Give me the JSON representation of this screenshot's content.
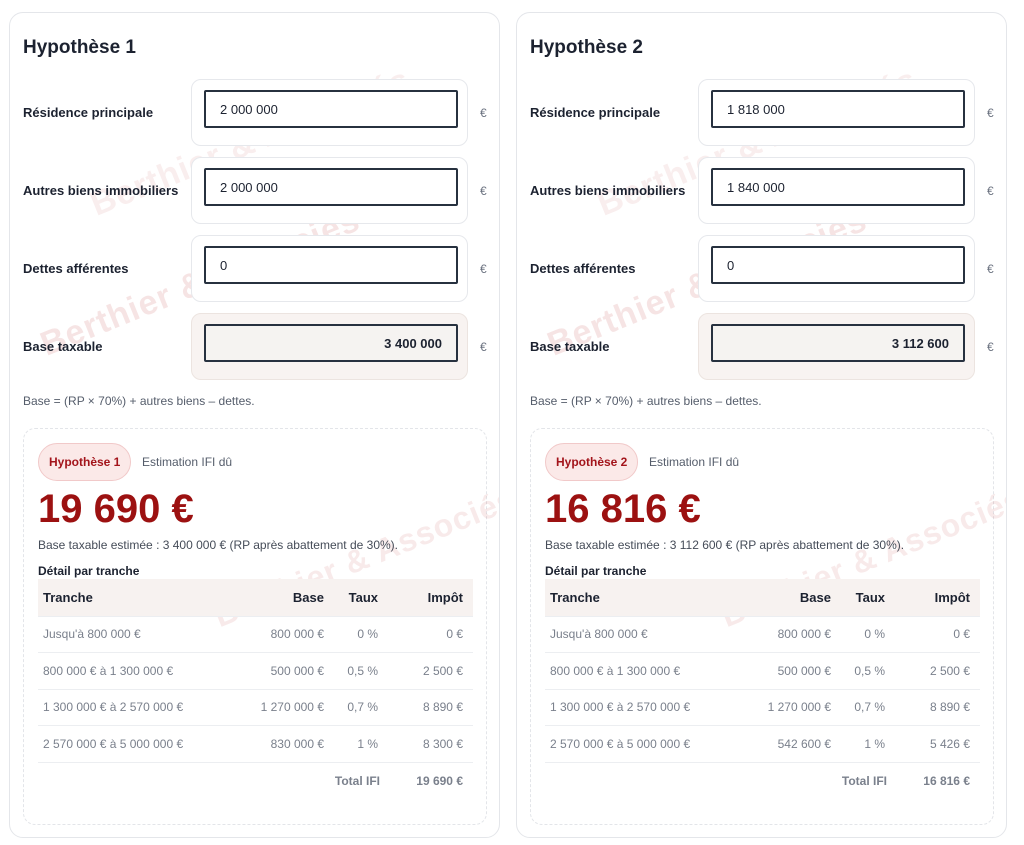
{
  "currency_symbol": "€",
  "colors": {
    "accent": "#9c1111",
    "pill_bg": "#fbe9e8",
    "input_border": "#27313f"
  },
  "watermark_text": "Berthier & Associés",
  "labels": {
    "rp": "Résidence principale",
    "autres": "Autres biens immobiliers",
    "dettes": "Dettes afférentes",
    "base": "Base taxable",
    "formula": "Base = (RP × 70%) + autres biens – dettes.",
    "estimation": "Estimation IFI dû",
    "detail": "Détail par tranche",
    "col_tranche": "Tranche",
    "col_base": "Base",
    "col_taux": "Taux",
    "col_impot": "Impôt",
    "total": "Total IFI"
  },
  "hypotheses": [
    {
      "title": "Hypothèse 1",
      "pill": "Hypothèse 1",
      "rp": "2 000 000",
      "autres": "2 000 000",
      "dettes": "0",
      "base_taxable": "3 400 000",
      "amount": "19 690 €",
      "note": "Base taxable estimée : 3 400 000 € (RP après abattement de 30%).",
      "rows": [
        {
          "tranche": "Jusqu'à 800 000 €",
          "base": "800 000 €",
          "taux": "0 %",
          "impot": "0 €"
        },
        {
          "tranche": "800 000 € à 1 300 000 €",
          "base": "500 000 €",
          "taux": "0,5 %",
          "impot": "2 500 €"
        },
        {
          "tranche": "1 300 000 € à 2 570 000 €",
          "base": "1 270 000 €",
          "taux": "0,7 %",
          "impot": "8 890 €"
        },
        {
          "tranche": "2 570 000 € à 5 000 000 €",
          "base": "830 000 €",
          "taux": "1 %",
          "impot": "8 300 €"
        }
      ],
      "total": "19 690 €"
    },
    {
      "title": "Hypothèse 2",
      "pill": "Hypothèse 2",
      "rp": "1 818 000",
      "autres": "1 840 000",
      "dettes": "0",
      "base_taxable": "3 112 600",
      "amount": "16 816 €",
      "note": "Base taxable estimée : 3 112 600 € (RP après abattement de 30%).",
      "rows": [
        {
          "tranche": "Jusqu'à 800 000 €",
          "base": "800 000 €",
          "taux": "0 %",
          "impot": "0 €"
        },
        {
          "tranche": "800 000 € à 1 300 000 €",
          "base": "500 000 €",
          "taux": "0,5 %",
          "impot": "2 500 €"
        },
        {
          "tranche": "1 300 000 € à 2 570 000 €",
          "base": "1 270 000 €",
          "taux": "0,7 %",
          "impot": "8 890 €"
        },
        {
          "tranche": "2 570 000 € à 5 000 000 €",
          "base": "542 600 €",
          "taux": "1 %",
          "impot": "5 426 €"
        }
      ],
      "total": "16 816 €"
    }
  ]
}
